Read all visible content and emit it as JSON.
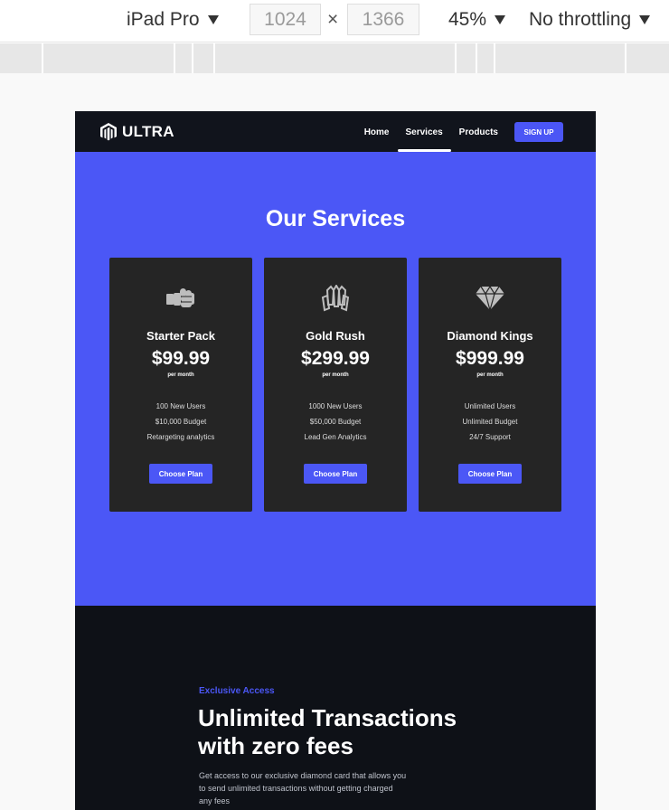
{
  "devtools": {
    "device": "iPad Pro",
    "width": "1024",
    "height": "1366",
    "times": "×",
    "zoom": "45%",
    "throttling": "No throttling"
  },
  "site": {
    "logo_text": "ULTRA",
    "logo_icon": "magento-hexagon-icon",
    "nav": {
      "items": [
        {
          "label": "Home",
          "active": false
        },
        {
          "label": "Services",
          "active": true
        },
        {
          "label": "Products",
          "active": false
        }
      ],
      "signup": "SIGN UP"
    },
    "services": {
      "title": "Our Services",
      "cards": [
        {
          "icon": "fist-bump-icon",
          "name": "Starter Pack",
          "price": "$99.99",
          "period": "per month",
          "features": [
            "100 New Users",
            "$10,000 Budget",
            "Retargeting analytics"
          ],
          "button": "Choose Plan"
        },
        {
          "icon": "gem-cluster-icon",
          "name": "Gold Rush",
          "price": "$299.99",
          "period": "per month",
          "features": [
            "1000 New Users",
            "$50,000 Budget",
            "Lead Gen Analytics"
          ],
          "button": "Choose Plan"
        },
        {
          "icon": "diamond-icon",
          "name": "Diamond Kings",
          "price": "$999.99",
          "period": "per month",
          "features": [
            "Unlimited Users",
            "Unlimited Budget",
            "24/7 Support"
          ],
          "button": "Choose Plan"
        }
      ]
    },
    "promo": {
      "eyebrow": "Exclusive Access",
      "headline_line1": "Unlimited Transactions",
      "headline_line2": "with zero fees",
      "text_line1": "Get access to our exclusive diamond card that allows you",
      "text_line2": "to send unlimited transactions without getting charged",
      "text_line3": "any fees"
    },
    "colors": {
      "accent": "#4b57f6",
      "nav_bg": "#11141c",
      "card_bg": "#252525",
      "dark_bg": "#0e1117"
    }
  }
}
